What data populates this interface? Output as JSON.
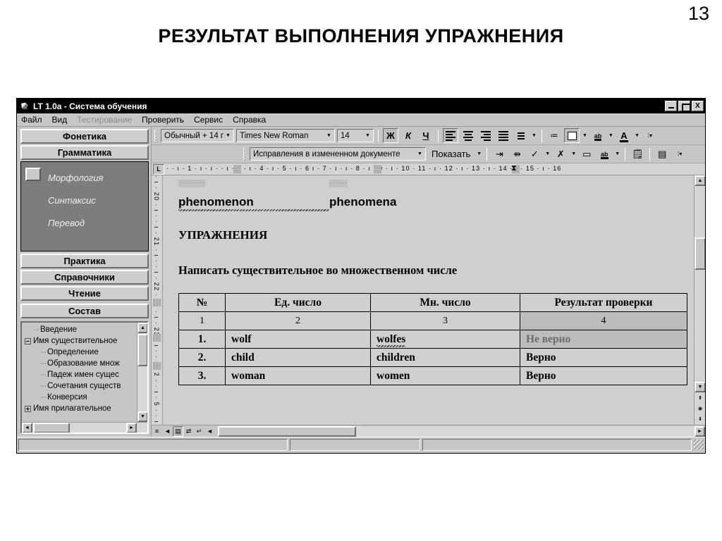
{
  "slide": {
    "page_number": "13",
    "title": "РЕЗУЛЬТАТ ВЫПОЛНЕНИЯ УПРАЖНЕНИЯ"
  },
  "window": {
    "title": "LT 1.0a - Система обучения",
    "buttons": {
      "minimize": "_",
      "maximize": "□",
      "close": "X"
    }
  },
  "menubar": {
    "items": [
      {
        "label": "Файл",
        "disabled": false
      },
      {
        "label": "Вид",
        "disabled": false
      },
      {
        "label": "Тестирование",
        "disabled": true
      },
      {
        "label": "Проверить",
        "disabled": false
      },
      {
        "label": "Сервис",
        "disabled": false
      },
      {
        "label": "Справка",
        "disabled": false
      }
    ]
  },
  "sidebar": {
    "buttons": [
      {
        "label": "Фонетика"
      },
      {
        "label": "Грамматика"
      }
    ],
    "subitems": [
      {
        "label": "Морфология"
      },
      {
        "label": "Синтаксис"
      },
      {
        "label": "Перевод"
      }
    ],
    "buttons_lower": [
      {
        "label": "Практика"
      },
      {
        "label": "Справочники"
      },
      {
        "label": "Чтение"
      }
    ],
    "composition_label": "Состав",
    "tree": [
      {
        "label": "Введение",
        "level": 1,
        "expander": "none"
      },
      {
        "label": "Имя существительное",
        "level": 1,
        "expander": "minus"
      },
      {
        "label": "Определение",
        "level": 2,
        "expander": "none"
      },
      {
        "label": "Образование множ",
        "level": 2,
        "expander": "none"
      },
      {
        "label": "Падеж имен сущес",
        "level": 2,
        "expander": "none"
      },
      {
        "label": "Сочетания существ",
        "level": 2,
        "expander": "none"
      },
      {
        "label": "Конверсия",
        "level": 2,
        "expander": "none"
      },
      {
        "label": "Имя прилагательное",
        "level": 1,
        "expander": "plus"
      }
    ]
  },
  "formatting_toolbar": {
    "style": "Обычный + 14 п",
    "font": "Times New Roman",
    "size": "14",
    "bold": "Ж",
    "italic": "К",
    "underline": "Ч",
    "align_left": "align-left",
    "align_center": "align-center",
    "align_right": "align-right",
    "align_justify": "align-justify",
    "line_spacing": "line-spacing",
    "numbering": "numbering",
    "borders": "borders",
    "highlight": "ab",
    "font_color": "A"
  },
  "reviewing_toolbar": {
    "display_mode": "Исправления в измененном документе",
    "show": "Показать",
    "buttons": [
      "previous-change",
      "next-change",
      "accept-change",
      "reject-change",
      "new-comment",
      "highlight",
      "track-changes",
      "reviewing-pane"
    ]
  },
  "ruler": {
    "tab_selector": "L",
    "horizontal_scale": "· · ı · 1 · ı · ı ·       · ı · 3 · ı · 4 · ı · 5 · ı · 6    ı · 7 · ı · ı · 8 · ı · 9 · ı · 10 ·       11 · ı · 12 · ı · 13 · ı · 14 · ı · 15 · ı · 16",
    "vertical_scale": "· ı · 20 · ı ·  · ı · 21 · ı ·  · ı · 22 · ı ·  · ı · 23 · ı ·  · ı · 2 ·  · ı · 5 ·  · ı · 6"
  },
  "document": {
    "word_rows": [
      {
        "singular": "phenomenon",
        "plural": "phenomena"
      }
    ],
    "exercise_heading": "УПРАЖНЕНИЯ",
    "exercise_task": "Написать существительное во множественном числе",
    "table": {
      "headers": [
        "№",
        "Ед. число",
        "Мн. число",
        "Результат проверки"
      ],
      "column_numbers": [
        "1",
        "2",
        "3",
        "4"
      ],
      "rows": [
        {
          "num": "1.",
          "singular": "wolf",
          "plural": "wolfes",
          "result": "Не верно",
          "correct": false
        },
        {
          "num": "2.",
          "singular": "child",
          "plural": "children",
          "result": "Верно",
          "correct": true
        },
        {
          "num": "3.",
          "singular": "woman",
          "plural": "women",
          "result": "Верно",
          "correct": true
        }
      ]
    }
  },
  "view_buttons": [
    "normal-view",
    "web-layout-view",
    "print-layout-view",
    "outline-view",
    "reading-view",
    "scroll-left"
  ],
  "status_bar": {
    "panel1": "",
    "panel2": "",
    "panel3": ""
  },
  "colors": {
    "window_bg": "#c6c6c6",
    "titlebar_bg": "#000000",
    "subpanel_bg": "#7d7d7d",
    "page_bg": "#cfcfcf",
    "shade_cell": "#bcbcbc",
    "wrong_text": "#6d6d6d"
  }
}
